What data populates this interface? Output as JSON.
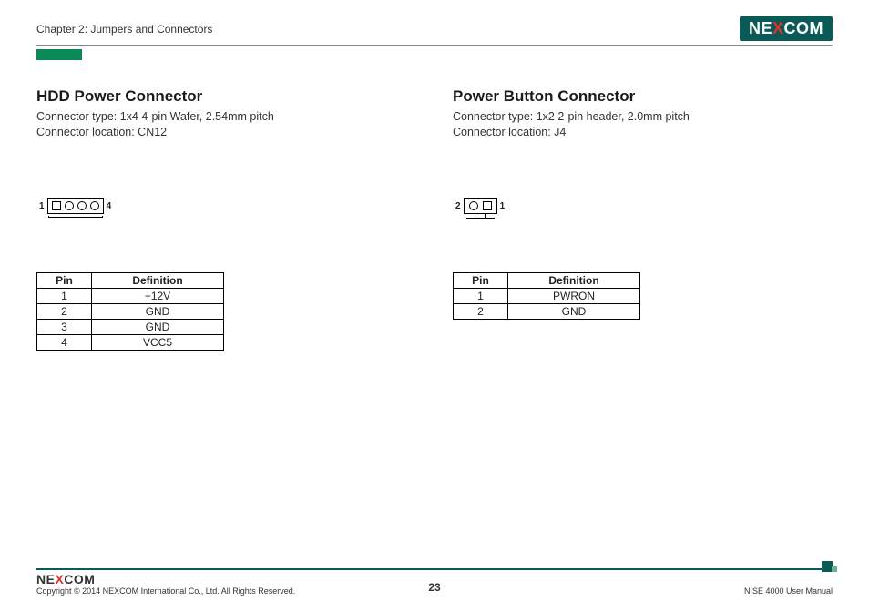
{
  "header": {
    "chapter": "Chapter 2: Jumpers and Connectors",
    "logo_pre": "NE",
    "logo_x": "X",
    "logo_post": "COM"
  },
  "left": {
    "title": "HDD Power Connector",
    "type_line": "Connector type: 1x4 4-pin Wafer, 2.54mm pitch",
    "loc_line": "Connector location: CN12",
    "diagram": {
      "left_label": "1",
      "right_label": "4"
    },
    "table": {
      "headers": {
        "pin": "Pin",
        "def": "Definition"
      },
      "rows": [
        {
          "pin": "1",
          "def": "+12V"
        },
        {
          "pin": "2",
          "def": "GND"
        },
        {
          "pin": "3",
          "def": "GND"
        },
        {
          "pin": "4",
          "def": "VCC5"
        }
      ]
    }
  },
  "right": {
    "title": "Power Button Connector",
    "type_line": "Connector type: 1x2 2-pin header, 2.0mm pitch",
    "loc_line": "Connector location: J4",
    "diagram": {
      "left_label": "2",
      "right_label": "1"
    },
    "table": {
      "headers": {
        "pin": "Pin",
        "def": "Definition"
      },
      "rows": [
        {
          "pin": "1",
          "def": "PWRON"
        },
        {
          "pin": "2",
          "def": "GND"
        }
      ]
    }
  },
  "footer": {
    "logo_pre": "NE",
    "logo_x": "X",
    "logo_post": "COM",
    "copyright": "Copyright © 2014 NEXCOM International Co., Ltd. All Rights Reserved.",
    "page": "23",
    "manual": "NISE 4000 User Manual"
  }
}
